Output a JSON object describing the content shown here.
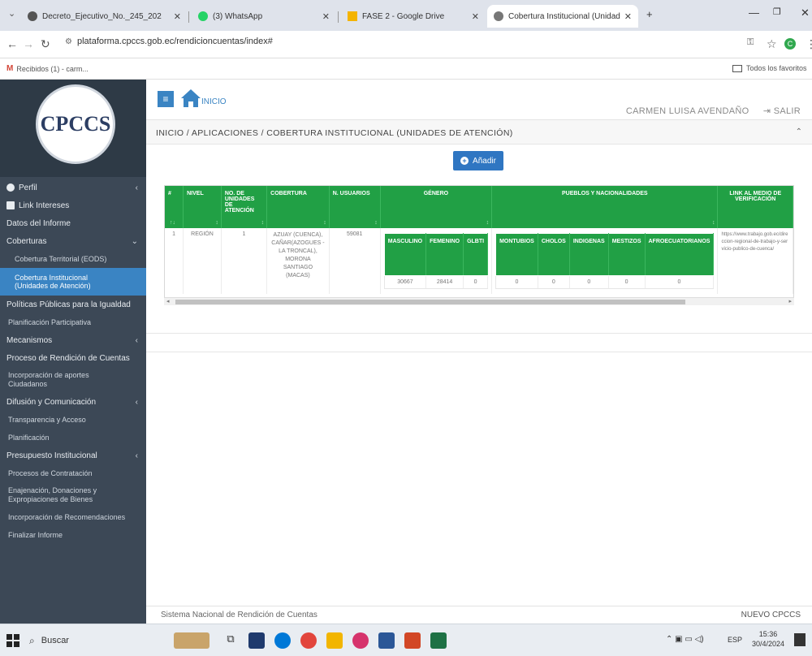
{
  "browser": {
    "tabs": [
      {
        "title": "Decreto_Ejecutivo_No._245_202",
        "fav_color": "#555"
      },
      {
        "title": "(3) WhatsApp",
        "fav_color": "#25d366"
      },
      {
        "title": "FASE 2 - Google Drive",
        "fav_color": "#f4b400"
      },
      {
        "title": "Cobertura Institucional (Unidad",
        "fav_color": "#777"
      }
    ],
    "new_tab": "+",
    "url": "plataforma.cpccs.gob.ec/rendicioncuentas/index#",
    "bookmark": "Recibidos (1) - carm...",
    "bookmarks_all": "Todos los favoritos"
  },
  "header": {
    "home_label": "INICIO",
    "user": "CARMEN LUISA AVENDAÑO",
    "logout": "SALIR"
  },
  "logo_text": "CPCCS",
  "sidebar": {
    "items": [
      {
        "label": "Perfil",
        "type": "main",
        "chev": "‹",
        "icon": "user-icon"
      },
      {
        "label": "Link Intereses",
        "type": "main",
        "icon": "link-icon"
      },
      {
        "label": "Datos del Informe",
        "type": "main"
      },
      {
        "label": "Coberturas",
        "type": "main",
        "chev": "⌄"
      },
      {
        "label": "Cobertura Territorial (EODS)",
        "type": "sub"
      },
      {
        "label": "Cobertura Institucional",
        "label2": "(Unidades de Atención)",
        "type": "selected"
      },
      {
        "label": "Políticas Públicas para la Igualdad",
        "type": "main"
      },
      {
        "label": "Planificación Participativa",
        "type": "sub0"
      },
      {
        "label": "Mecanismos",
        "type": "main",
        "chev": "‹"
      },
      {
        "label": "Proceso de Rendición de Cuentas",
        "type": "main"
      },
      {
        "label": "Incorporación de aportes",
        "label2": "Ciudadanos",
        "type": "tall"
      },
      {
        "label": "Difusión y Comunicación",
        "type": "main",
        "chev": "‹"
      },
      {
        "label": "Transparencia y Acceso",
        "type": "sub0"
      },
      {
        "label": "Planificación",
        "type": "sub0"
      },
      {
        "label": "Presupuesto Institucional",
        "type": "main",
        "chev": "‹"
      },
      {
        "label": "Procesos de Contratación",
        "type": "sub0"
      },
      {
        "label": "Enajenación, Donaciones y",
        "label2": "Expropiaciones de Bienes",
        "type": "tall"
      },
      {
        "label": "Incorporación de Recomendaciones",
        "type": "sub0"
      },
      {
        "label": "Finalizar Informe",
        "type": "sub0"
      }
    ]
  },
  "breadcrumb": "INICIO / APLICACIONES / COBERTURA INSTITUCIONAL (UNIDADES DE ATENCIÓN)",
  "add_button": "Añadir",
  "table": {
    "headers": [
      "#",
      "NIVEL",
      "NO. DE UNIDADES DE ATENCIÓN",
      "COBERTURA",
      "N. USUARIOS",
      "GÉNERO",
      "PUEBLOS Y NACIONALIDADES",
      "LINK AL MEDIO DE VERIFICACIÓN"
    ],
    "row": {
      "num": "1",
      "nivel": "REGIÓN",
      "unidades": "1",
      "cobertura": "AZUAY (CUENCA), CAÑAR(AZOGUES - LA TRONCAL), MORONA SANTIAGO (MACAS)",
      "usuarios": "59081",
      "genero_headers": [
        "MASCULINO",
        "FEMENINO",
        "GLBTI"
      ],
      "genero_values": [
        "30667",
        "28414",
        "0"
      ],
      "pueblos_headers": [
        "MONTUBIOS",
        "CHOLOS",
        "INDIGENAS",
        "MESTIZOS",
        "AFROECUATORIANOS"
      ],
      "pueblos_values": [
        "0",
        "0",
        "0",
        "0",
        "0"
      ],
      "link": "https://www.trabajo.gob.ec/direccion-regional-de-trabajo-y-servicio-publico-de-cuenca/"
    }
  },
  "footer": {
    "left": "Sistema Nacional de Rendición de Cuentas",
    "right": "NUEVO CPCCS"
  },
  "taskbar": {
    "search": "Buscar",
    "lang": "ESP",
    "time": "15:36",
    "date": "30/4/2024"
  }
}
